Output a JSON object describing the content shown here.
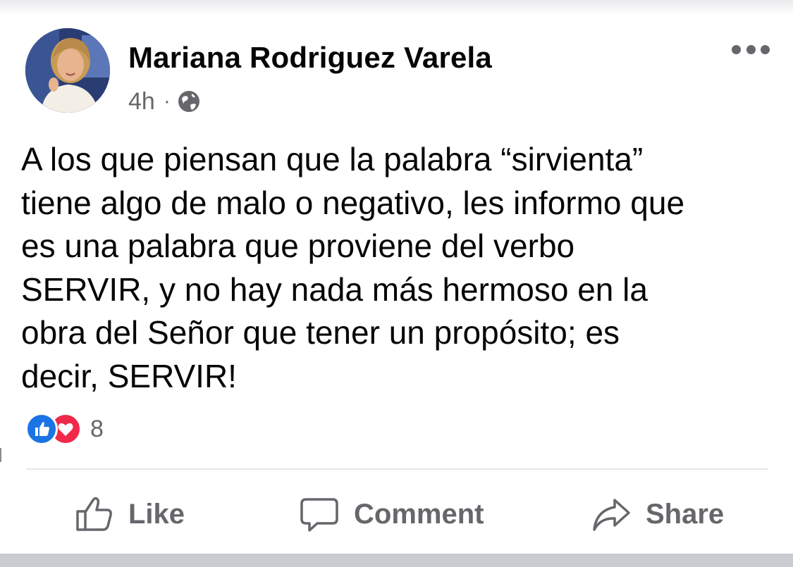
{
  "post": {
    "author": "Mariana Rodriguez Varela",
    "time": "4h",
    "separator": "·",
    "privacy_icon": "globe-icon",
    "more_icon": "more-options-icon",
    "text_lines": [
      "A los que piensan que la palabra “sirvienta”",
      "tiene algo de malo o negativo, les informo que",
      "es una palabra que proviene del verbo",
      "SERVIR, y no hay nada más hermoso en la",
      "obra del Señor que tener un propósito; es",
      "decir, SERVIR!"
    ],
    "reactions": {
      "types": [
        "like-reaction-icon",
        "love-reaction-icon"
      ],
      "count": "8"
    }
  },
  "actions": {
    "like": "Like",
    "comment": "Comment",
    "share": "Share"
  },
  "colors": {
    "text": "#050505",
    "secondary": "#65676b",
    "like_blue": "#1b74e4",
    "love_red": "#f0284a",
    "divider": "#e4e6eb"
  }
}
